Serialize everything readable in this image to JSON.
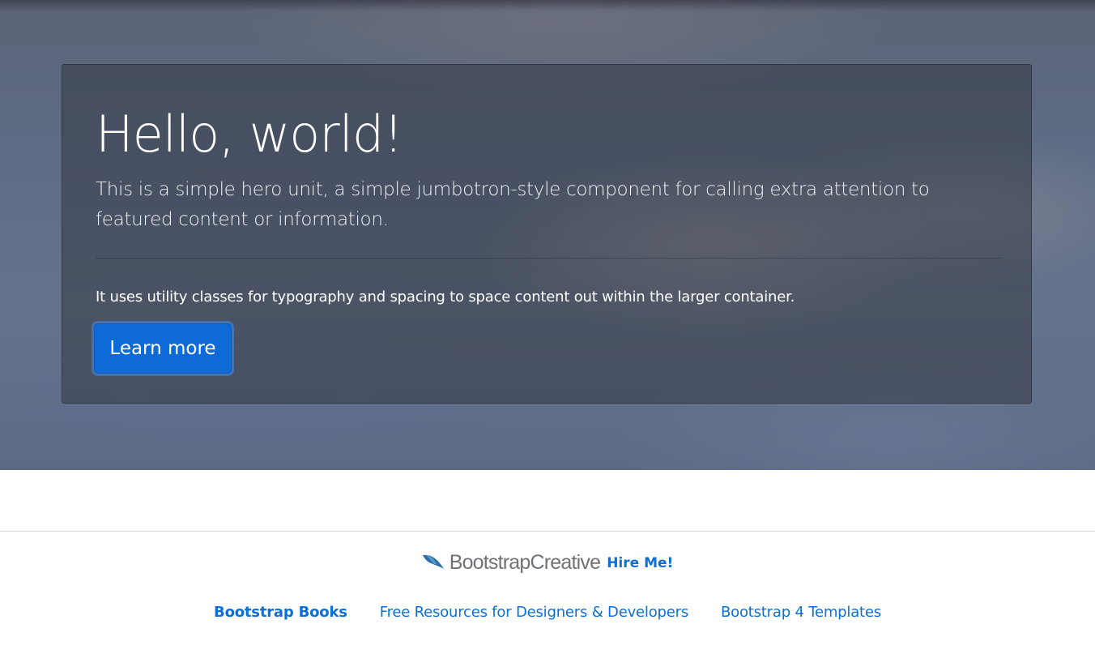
{
  "hero": {
    "heading": "Hello, world!",
    "lead": "This is a simple hero unit, a simple jumbotron-style component for calling extra attention to featured content or information.",
    "body": "It uses utility classes for typography and spacing to space content out within the larger container.",
    "button_label": "Learn more"
  },
  "footer": {
    "brand_name": "BootstrapCreative",
    "hire_label": "Hire Me!",
    "links": [
      {
        "label": "Bootstrap Books"
      },
      {
        "label": "Free Resources for Designers & Developers"
      },
      {
        "label": "Bootstrap 4 Templates"
      }
    ]
  },
  "colors": {
    "primary": "#0d6ad6",
    "link": "#0a6fd8",
    "brand_gray": "#6f7378"
  },
  "icons": {
    "brand": "bootstrapcreative-swoosh-icon"
  }
}
